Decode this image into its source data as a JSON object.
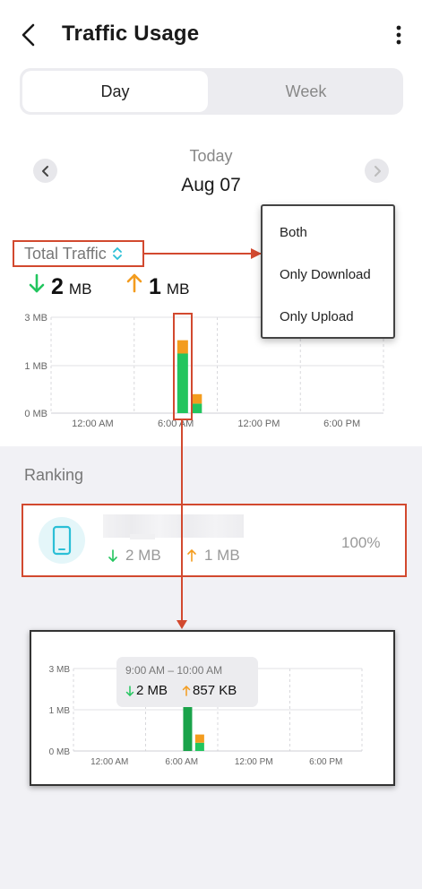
{
  "header": {
    "title": "Traffic Usage"
  },
  "segment": {
    "day": "Day",
    "week": "Week",
    "selected": "Day"
  },
  "date": {
    "relative": "Today",
    "date": "Aug 07"
  },
  "traffic_selector": {
    "label": "Total Traffic"
  },
  "summary": {
    "download_value": "2",
    "download_unit": "MB",
    "upload_value": "1",
    "upload_unit": "MB"
  },
  "dropdown": {
    "options": [
      "Both",
      "Only Download",
      "Only Upload"
    ]
  },
  "ranking": {
    "title": "Ranking",
    "items": [
      {
        "download": "2 MB",
        "upload": "1 MB",
        "percent": "100%"
      }
    ]
  },
  "tooltip": {
    "time": "9:00 AM – 10:00 AM",
    "download": "2 MB",
    "upload": "857 KB"
  },
  "colors": {
    "download": "#22c55e",
    "upload": "#f39c1e",
    "highlight": "#d2492f",
    "accent": "#2bbfd6"
  },
  "chart_data": [
    {
      "type": "bar",
      "stacked": true,
      "y_ticks": [
        "0 MB",
        "1 MB",
        "3 MB"
      ],
      "x_ticks": [
        "12:00 AM",
        "6:00 AM",
        "12:00 PM",
        "6:00 PM"
      ],
      "ylim": [
        0,
        3
      ],
      "hours": [
        9,
        10
      ],
      "series": [
        {
          "name": "Download",
          "values": [
            1.5,
            0.2
          ]
        },
        {
          "name": "Upload",
          "values": [
            0.55,
            0.2
          ]
        }
      ]
    },
    {
      "type": "bar",
      "stacked": true,
      "y_ticks": [
        "0 MB",
        "1 MB",
        "3 MB"
      ],
      "x_ticks": [
        "12:00 AM",
        "6:00 AM",
        "12:00 PM",
        "6:00 PM"
      ],
      "ylim": [
        0,
        3
      ],
      "hours": [
        9,
        10
      ],
      "series": [
        {
          "name": "Download",
          "values": [
            1.45,
            0.2
          ]
        },
        {
          "name": "Upload",
          "values": [
            0,
            0.2
          ]
        }
      ]
    }
  ]
}
